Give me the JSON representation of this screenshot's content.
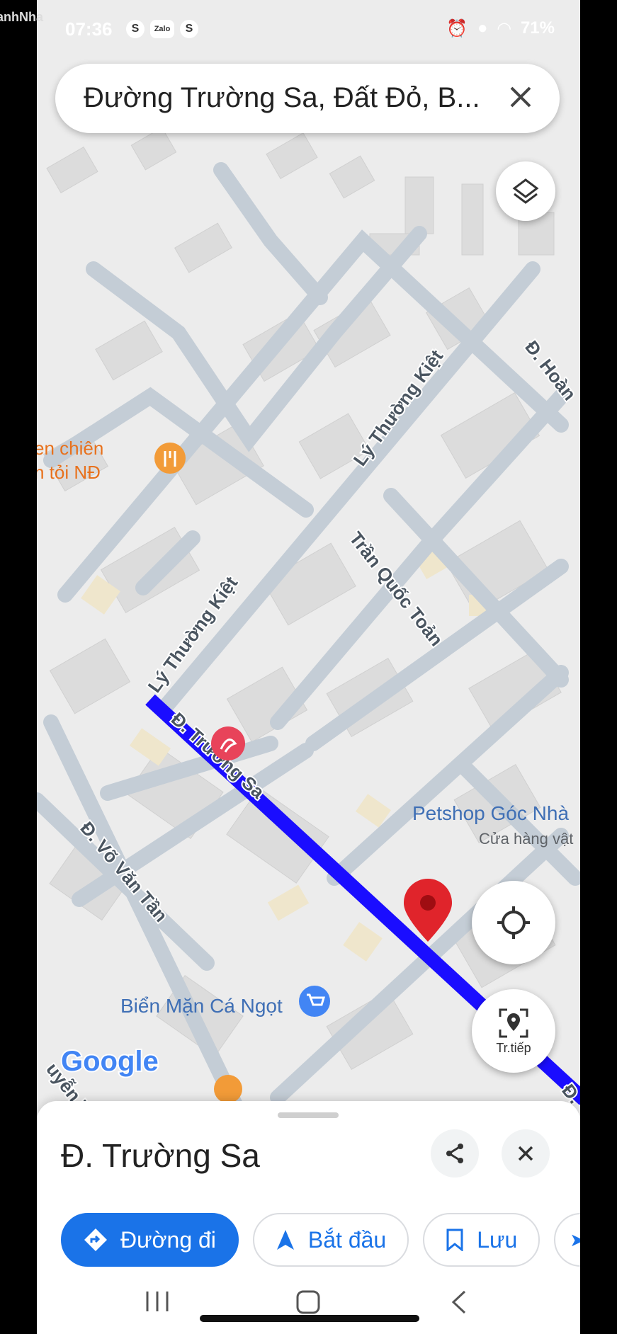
{
  "status_bar": {
    "time": "07:36",
    "app_icons": [
      "S",
      "Zalo",
      "S"
    ],
    "right_text": "71%"
  },
  "watermark": "SoSanhNha",
  "search": {
    "query": "Đường Trường Sa, Đất Đỏ, B...",
    "close_icon": "close-icon"
  },
  "map": {
    "street_labels": {
      "truong_sa": "Đ. Trường Sa",
      "ly_thuong_kiet_1": "Lý Thường Kiệt",
      "ly_thuong_kiet_2": "Lý Thường Kiệt",
      "tran_quoc_toan": "Trần Quốc Toản",
      "vo_van_tan": "Đ. Võ Văn Tần",
      "hoang": "Đ. Hoàn",
      "nguyen": "uyễn Tr",
      "truong_sa_edge": "Đ."
    },
    "pois": {
      "restaurant_line1": "en chiên",
      "restaurant_line2": "n tỏi NĐ",
      "petshop_name": "Petshop Góc Nhà",
      "petshop_sub": "Cửa hàng vật",
      "shop_name": "Biển Mặn Cá Ngọt"
    },
    "google_logo": "Google",
    "colors": {
      "route": "#1a0dff",
      "pin": "#e0242b",
      "accent": "#1a73e8"
    }
  },
  "fabs": {
    "layers_icon": "layers-icon",
    "location_icon": "my-location-icon",
    "continue_label": "Tr.tiếp"
  },
  "sheet": {
    "title": "Đ. Trường Sa",
    "chips": {
      "directions": "Đường đi",
      "start": "Bắt đầu",
      "save": "Lưu"
    }
  },
  "nav_bar": {
    "recent_icon": "recent-apps-icon",
    "home_icon": "home-icon",
    "back_icon": "back-icon"
  }
}
